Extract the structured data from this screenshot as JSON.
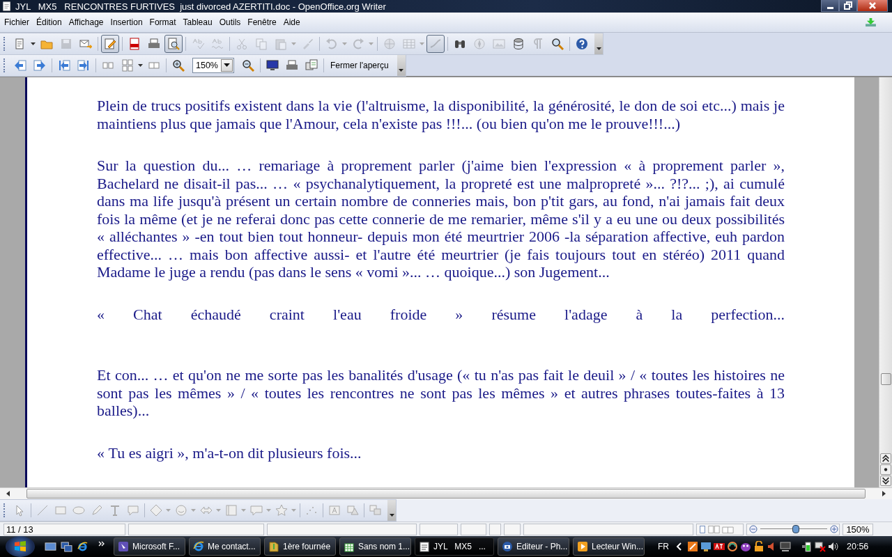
{
  "window": {
    "title": "JYL   MX5   RENCONTRES FURTIVES  just divorced AZERTITI.doc - OpenOffice.org Writer"
  },
  "menu": [
    "Fichier",
    "Édition",
    "Affichage",
    "Insertion",
    "Format",
    "Tableau",
    "Outils",
    "Fenêtre",
    "Aide"
  ],
  "standard_toolbar": [
    {
      "kind": "new",
      "disabled": false,
      "pressed": false,
      "dropdown": true
    },
    {
      "kind": "open",
      "disabled": false,
      "pressed": false,
      "dropdown": false
    },
    {
      "kind": "save",
      "disabled": true,
      "pressed": false,
      "dropdown": false
    },
    {
      "kind": "mail",
      "disabled": false,
      "pressed": false,
      "dropdown": false
    },
    {
      "kind": "separator"
    },
    {
      "kind": "edit",
      "disabled": false,
      "pressed": true,
      "dropdown": false
    },
    {
      "kind": "separator"
    },
    {
      "kind": "pdf",
      "disabled": false,
      "pressed": false,
      "dropdown": false
    },
    {
      "kind": "print",
      "disabled": false,
      "pressed": false,
      "dropdown": false
    },
    {
      "kind": "preview",
      "disabled": false,
      "pressed": true,
      "dropdown": false
    },
    {
      "kind": "separator"
    },
    {
      "kind": "spell",
      "disabled": true,
      "pressed": false,
      "dropdown": false
    },
    {
      "kind": "autospell",
      "disabled": true,
      "pressed": false,
      "dropdown": false
    },
    {
      "kind": "separator"
    },
    {
      "kind": "cut",
      "disabled": true,
      "pressed": false,
      "dropdown": false
    },
    {
      "kind": "copy",
      "disabled": true,
      "pressed": false,
      "dropdown": false
    },
    {
      "kind": "paste",
      "disabled": true,
      "pressed": false,
      "dropdown": true
    },
    {
      "kind": "brush",
      "disabled": true,
      "pressed": false,
      "dropdown": false
    },
    {
      "kind": "separator"
    },
    {
      "kind": "undo",
      "disabled": true,
      "pressed": false,
      "dropdown": true
    },
    {
      "kind": "redo",
      "disabled": true,
      "pressed": false,
      "dropdown": true
    },
    {
      "kind": "separator"
    },
    {
      "kind": "hyperlink",
      "disabled": true,
      "pressed": false,
      "dropdown": false
    },
    {
      "kind": "table",
      "disabled": true,
      "pressed": false,
      "dropdown": true
    },
    {
      "kind": "draw",
      "disabled": true,
      "pressed": true,
      "dropdown": false
    },
    {
      "kind": "separator"
    },
    {
      "kind": "find",
      "disabled": false,
      "pressed": false,
      "dropdown": false
    },
    {
      "kind": "navigator",
      "disabled": true,
      "pressed": false,
      "dropdown": false
    },
    {
      "kind": "gallery",
      "disabled": true,
      "pressed": false,
      "dropdown": false
    },
    {
      "kind": "database",
      "disabled": false,
      "pressed": false,
      "dropdown": false
    },
    {
      "kind": "pilcrow",
      "disabled": true,
      "pressed": false,
      "dropdown": false
    },
    {
      "kind": "zoom",
      "disabled": false,
      "pressed": false,
      "dropdown": false
    },
    {
      "kind": "separator"
    },
    {
      "kind": "help",
      "disabled": false,
      "pressed": false,
      "dropdown": false
    }
  ],
  "preview_toolbar": {
    "items_before_zoom": [
      {
        "kind": "prev",
        "disabled": false,
        "pressed": false,
        "dropdown": false
      },
      {
        "kind": "next",
        "disabled": false,
        "pressed": false,
        "dropdown": false
      },
      {
        "kind": "separator"
      },
      {
        "kind": "first",
        "disabled": false,
        "pressed": false,
        "dropdown": false
      },
      {
        "kind": "last",
        "disabled": false,
        "pressed": false,
        "dropdown": false
      },
      {
        "kind": "separator"
      },
      {
        "kind": "twopages",
        "disabled": false,
        "pressed": false,
        "dropdown": false
      },
      {
        "kind": "multipages",
        "disabled": false,
        "pressed": false,
        "dropdown": true
      },
      {
        "kind": "book",
        "disabled": false,
        "pressed": false,
        "dropdown": false
      },
      {
        "kind": "separator"
      },
      {
        "kind": "zoomin",
        "disabled": false,
        "pressed": false,
        "dropdown": false
      }
    ],
    "zoom_value": "150%",
    "items_after_zoom": [
      {
        "kind": "zoomout",
        "disabled": false,
        "pressed": false,
        "dropdown": false
      },
      {
        "kind": "separator"
      },
      {
        "kind": "fullscreen",
        "disabled": false,
        "pressed": false,
        "dropdown": false
      },
      {
        "kind": "print",
        "disabled": false,
        "pressed": false,
        "dropdown": false
      },
      {
        "kind": "printopts",
        "disabled": false,
        "pressed": false,
        "dropdown": false
      },
      {
        "kind": "separator"
      }
    ],
    "close_label": "Fermer l'aperçu"
  },
  "document": {
    "paragraphs": [
      {
        "text": "Plein de trucs positifs existent dans la vie (l'altruisme, la disponibilité, la générosité, le don de soi etc...) mais je maintiens plus que jamais que l'Amour, cela n'existe pas !!!... (ou bien qu'on me le prouve!!!...)",
        "justify_last": false
      },
      {
        "text": "Sur la question du... … remariage à proprement parler (j'aime bien l'expression « à proprement parler », Bachelard ne disait-il pas... … « psychanalytiquement, la propreté est une malpropreté »... ?!?...   ;), ai cumulé dans ma life jusqu'à présent un certain nombre de conneries mais, bon p'tit gars, au fond, n'ai jamais fait deux fois la même (et je ne referai donc pas cette connerie de me remarier, même s'il y a eu une ou deux possibilités « alléchantes » -en tout bien tout honneur- depuis mon été meurtrier 2006 -la séparation affective, euh pardon effective... … mais bon affective aussi- et l'autre été meurtrier (je fais toujours tout en stéréo) 2011 quand Madame le juge a rendu (pas dans le sens « vomi »... … quoique...) son Jugement...",
        "justify_last": false
      },
      {
        "text": "« Chat échaudé craint l'eau froide » résume l'adage à la perfection...",
        "justify_last": true
      },
      {
        "text": "Et con... … et qu'on ne me sorte pas les banalités d'usage (« tu n'as pas fait le deuil » / « toutes les histoires ne sont pas les mêmes » / « toutes les rencontres ne sont pas les mêmes » et autres phrases toutes-faites à 13 balles)...",
        "justify_last": false
      },
      {
        "text": "« Tu es aigri », m'a-t-on dit plusieurs fois...",
        "justify_last": false
      }
    ]
  },
  "status_bar": {
    "page": "11 / 13",
    "zoom_slider": {
      "level": 0.53
    },
    "zoom": "150%"
  },
  "taskbar": {
    "buttons": [
      {
        "label": "Microsoft F...",
        "kind": "app",
        "selected": false
      },
      {
        "label": "Me contact...",
        "kind": "browser",
        "selected": false
      },
      {
        "label": "1ère fournée",
        "kind": "folder",
        "selected": false
      },
      {
        "label": "Sans nom 1...",
        "kind": "calc",
        "selected": false
      },
      {
        "label": "JYL   MX5   ...",
        "kind": "writer",
        "selected": true
      },
      {
        "label": "Editeur - Ph...",
        "kind": "camera",
        "selected": false
      },
      {
        "label": "Lecteur Win...",
        "kind": "player",
        "selected": false
      }
    ],
    "language": "FR",
    "clock": "20:56"
  }
}
